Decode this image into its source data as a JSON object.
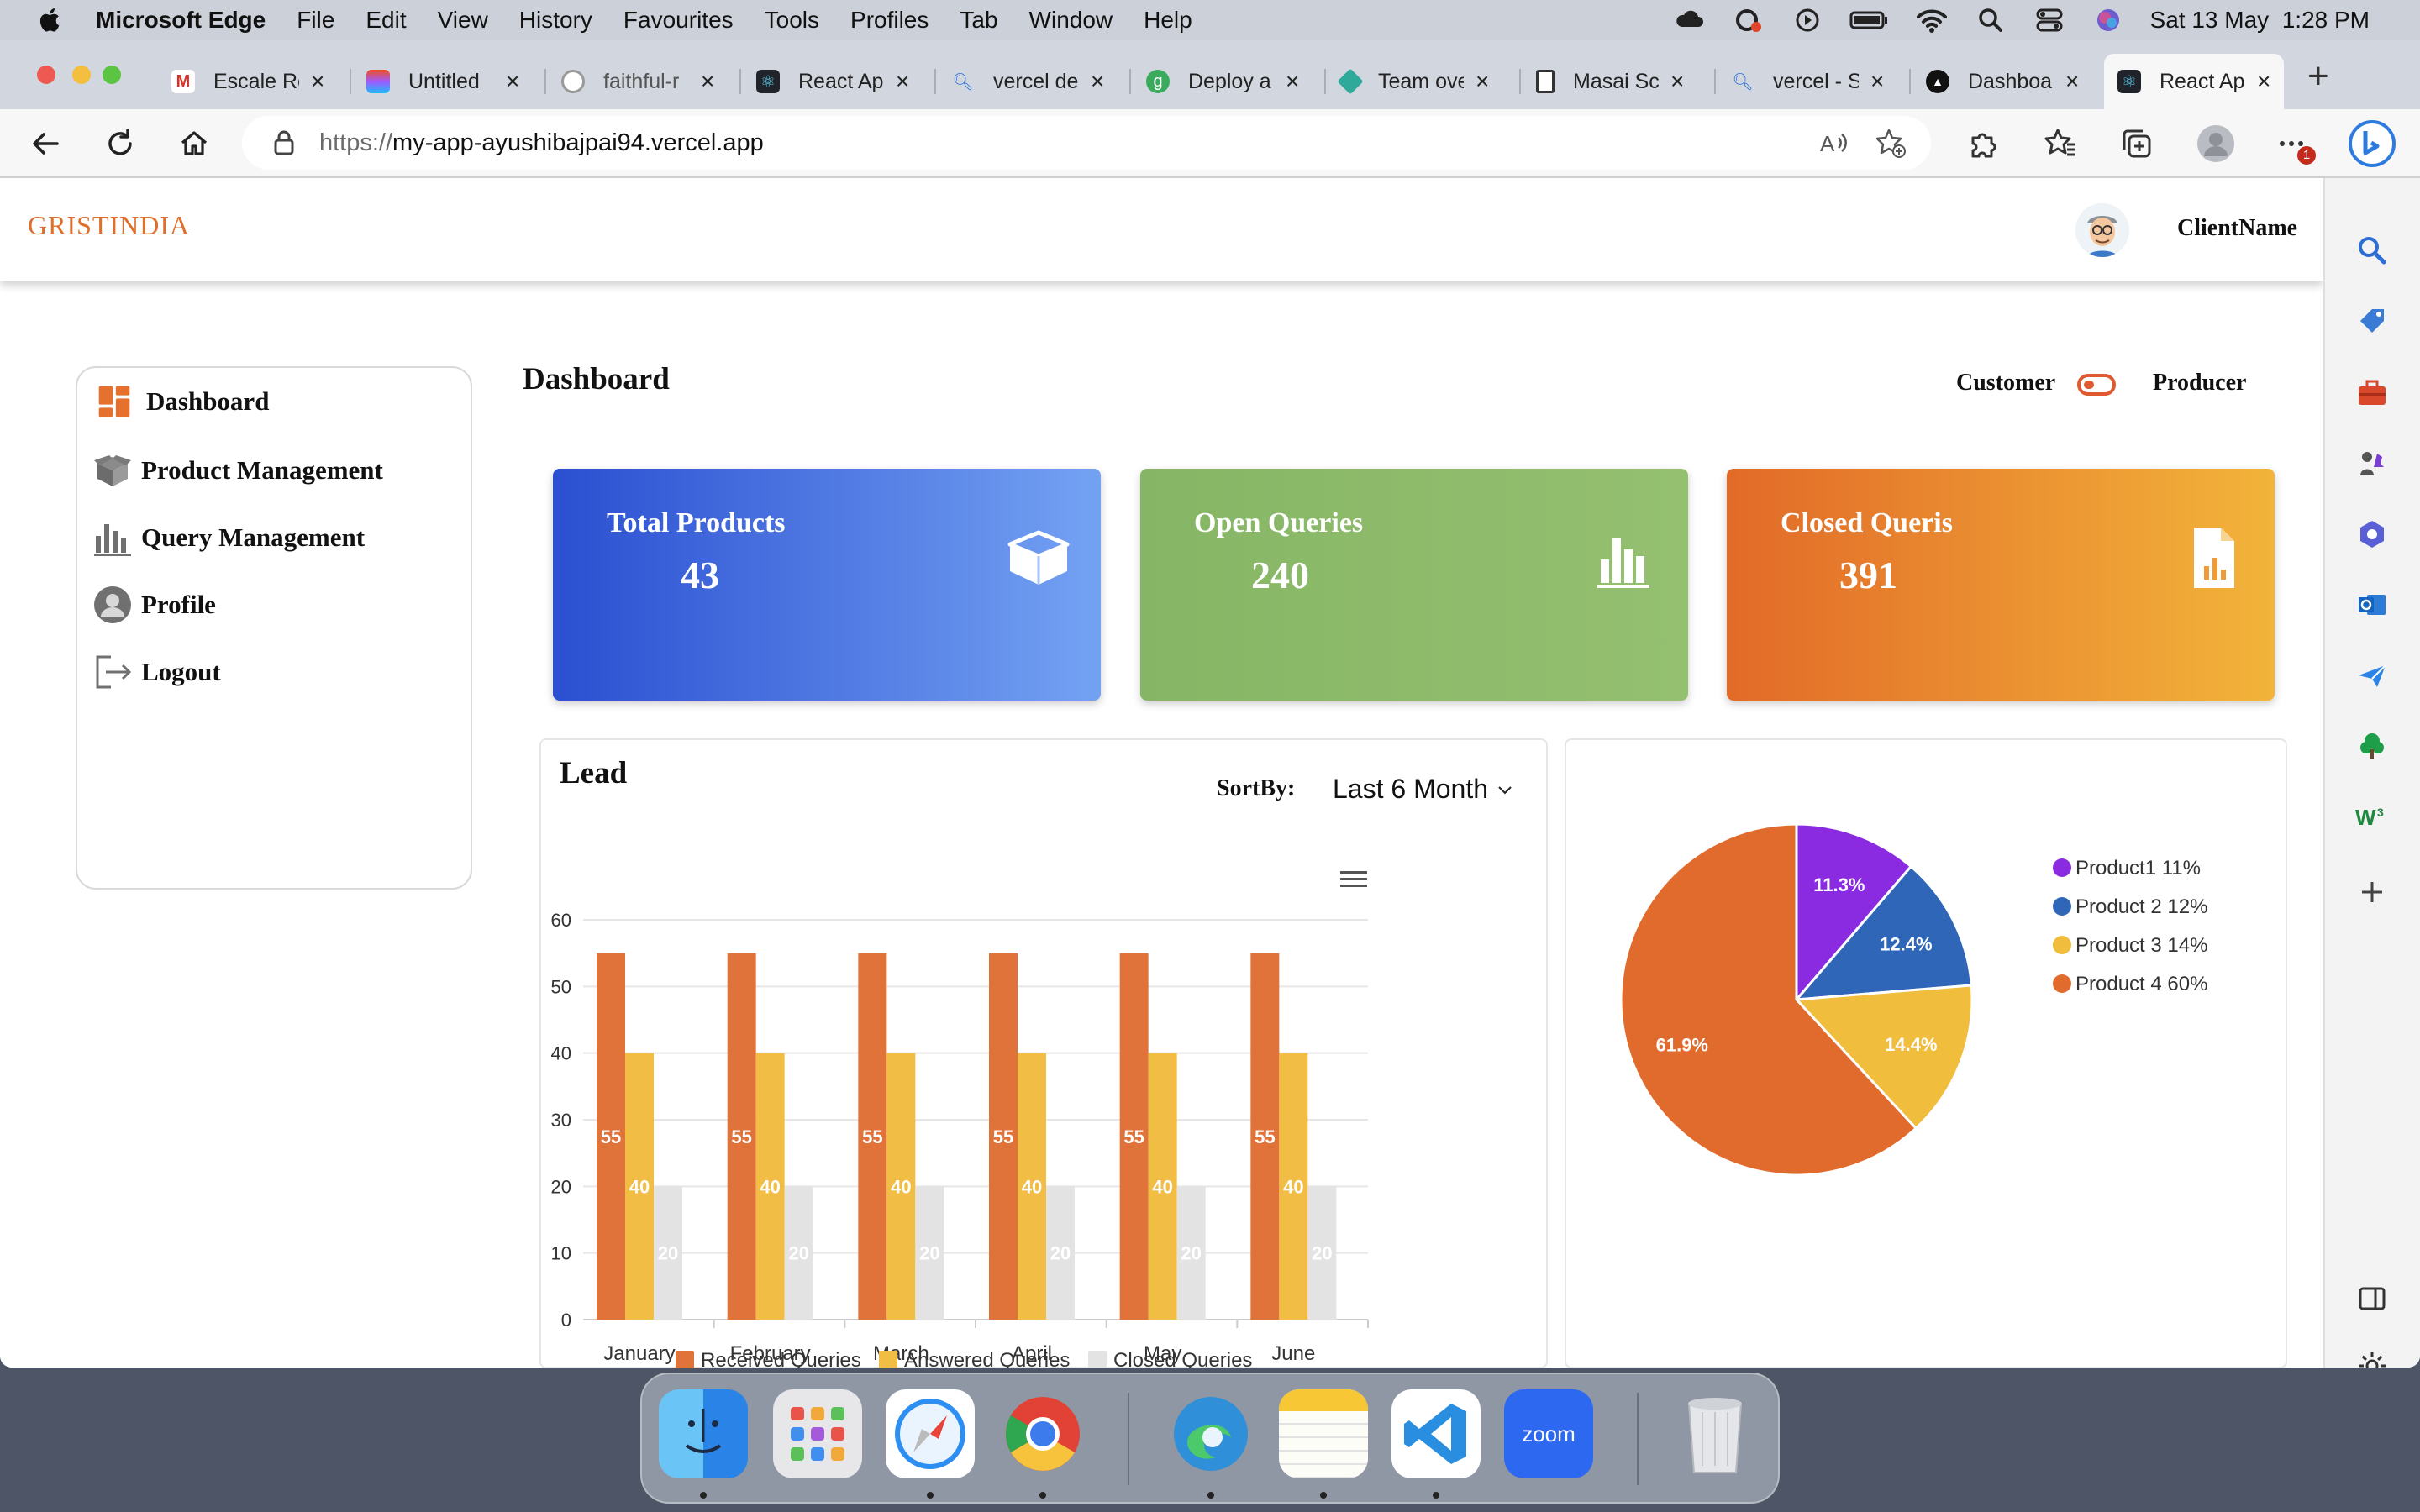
{
  "menubar": {
    "app_name": "Microsoft Edge",
    "items": [
      "File",
      "Edit",
      "View",
      "History",
      "Favourites",
      "Tools",
      "Profiles",
      "Tab",
      "Window",
      "Help"
    ],
    "datetime": "Sat 13 May  1:28 PM"
  },
  "browser": {
    "tabs": [
      {
        "label": "Escale Re",
        "icon": "gmail-icon"
      },
      {
        "label": "Untitled",
        "icon": "figma-icon"
      },
      {
        "label": "faithful-r",
        "icon": "github-icon"
      },
      {
        "label": "React Ap",
        "icon": "react-icon"
      },
      {
        "label": "vercel de",
        "icon": "search-icon"
      },
      {
        "label": "Deploy a",
        "icon": "deploy-icon"
      },
      {
        "label": "Team ove",
        "icon": "team-icon"
      },
      {
        "label": "Masai Sc",
        "icon": "document-icon"
      },
      {
        "label": "vercel - S",
        "icon": "search-icon"
      },
      {
        "label": "Dashboa",
        "icon": "vercel-icon"
      },
      {
        "label": "React Ap",
        "icon": "react-icon",
        "active": true
      }
    ],
    "url_scheme": "https://",
    "url_host": "my-app-ayushibajpai94.vercel.app",
    "notification_count": "1"
  },
  "app": {
    "logo": "GRISTINDIA",
    "client_name": "ClientName",
    "page_title": "Dashboard",
    "nav": [
      {
        "label": "Dashboard",
        "icon": "dashboard-icon"
      },
      {
        "label": "Product Management",
        "icon": "box-icon"
      },
      {
        "label": "Query Management",
        "icon": "bar-chart-icon"
      },
      {
        "label": "Profile",
        "icon": "user-icon"
      },
      {
        "label": "Logout",
        "icon": "logout-icon"
      }
    ],
    "role_toggle": {
      "left": "Customer",
      "right": "Producer"
    },
    "cards": [
      {
        "title": "Total Products",
        "value": "43",
        "icon": "box-icon",
        "color_from": "#2a4fd1",
        "color_to": "#74a2f3"
      },
      {
        "title": "Open Queries",
        "value": "240",
        "icon": "bar-chart-icon",
        "color_from": "#86b665",
        "color_to": "#94c070"
      },
      {
        "title": "Closed Queris",
        "value": "391",
        "icon": "document-chart-icon",
        "color_from": "#e26a28",
        "color_to": "#f2b43a"
      }
    ],
    "lead": {
      "title": "Lead",
      "sort_label": "SortBy:",
      "sort_value": "Last 6 Month"
    }
  },
  "chart_data": [
    {
      "type": "bar",
      "categories": [
        "January",
        "February",
        "March",
        "April",
        "May",
        "June"
      ],
      "series": [
        {
          "name": "Received Queries",
          "values": [
            55,
            55,
            55,
            55,
            55,
            55
          ],
          "color": "#e0733a"
        },
        {
          "name": "Answered Queries",
          "values": [
            40,
            40,
            40,
            40,
            40,
            40
          ],
          "color": "#f2bd45"
        },
        {
          "name": "Closed Queries",
          "values": [
            20,
            20,
            20,
            20,
            20,
            20
          ],
          "color": "#e3e3e3"
        }
      ],
      "yticks": [
        0,
        10,
        20,
        30,
        40,
        50,
        60
      ],
      "ylim": [
        0,
        60
      ],
      "legend": "bottom",
      "grid": true
    },
    {
      "type": "pie",
      "slices": [
        {
          "name": "Product1 11%",
          "value": 11.3,
          "label": "11.3%",
          "color": "#8a2be2"
        },
        {
          "name": "Product 2 12%",
          "value": 12.4,
          "label": "12.4%",
          "color": "#2f66b8"
        },
        {
          "name": "Product 3 14%",
          "value": 14.4,
          "label": "14.4%",
          "color": "#f0bd3c"
        },
        {
          "name": "Product 4 60%",
          "value": 61.9,
          "label": "61.9%",
          "color": "#e06b2c"
        }
      ],
      "legend": "right"
    }
  ]
}
